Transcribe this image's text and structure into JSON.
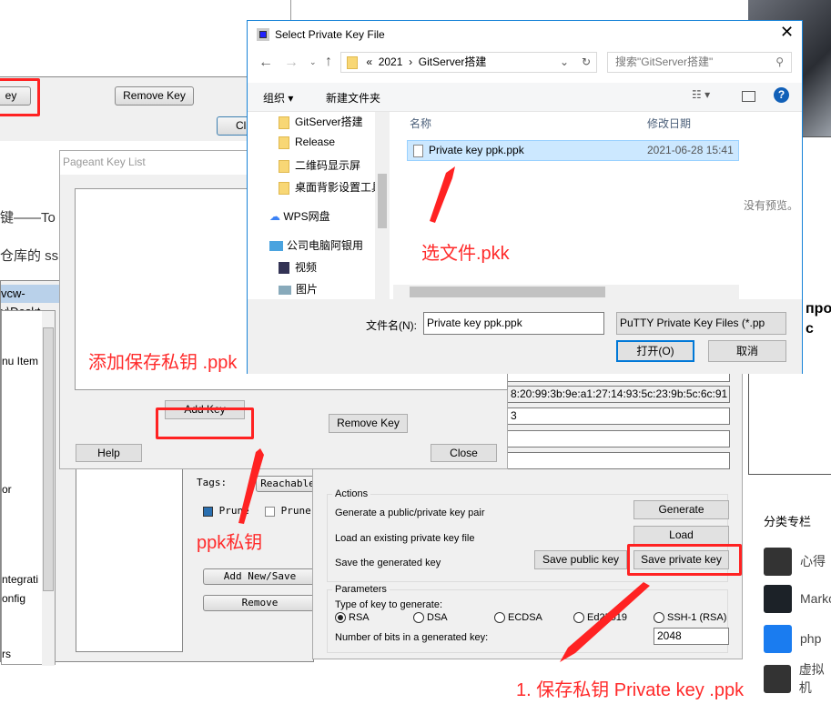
{
  "old_pageant": {
    "add_key_partial": "ey",
    "remove_key": "Remove Key",
    "close_partial": "Cl"
  },
  "blog": {
    "line1": "键——To",
    "line2": "仓库的 ssh",
    "sidebar_heading_partial": "про\nс",
    "category_title": "分类专栏",
    "categories": [
      "心得",
      "Marko",
      "php",
      "虚拟机"
    ],
    "no_preview": "没有预览。"
  },
  "tortoise": {
    "path_partial": "vcw-v\\Deskt",
    "tree": [
      "nu Item",
      "or",
      "ntegrati",
      "onfig",
      "rs"
    ],
    "tags_label": "Tags:",
    "reachable": "Reachable",
    "prune1": "Prune",
    "prune2": "Prune",
    "add_new_save": "Add New/Save",
    "remove": "Remove"
  },
  "puttygen": {
    "fingerprint": "8:20:99:3b:9e:a1:27:14:93:5c:23:9b:5c:6c:91",
    "comment_partial": "3",
    "actions_title": "Actions",
    "generate_label": "Generate a public/private key pair",
    "generate_btn": "Generate",
    "load_label": "Load an existing private key file",
    "load_btn": "Load",
    "save_label": "Save the generated key",
    "save_public": "Save public key",
    "save_private": "Save private key",
    "params_title": "Parameters",
    "type_label": "Type of key to generate:",
    "key_types": [
      "RSA",
      "DSA",
      "ECDSA",
      "Ed25519",
      "SSH-1 (RSA)"
    ],
    "selected_type": "RSA",
    "bits_label": "Number of bits in a generated key:",
    "bits": "2048"
  },
  "pageant": {
    "title": "Pageant Key List",
    "add_key": "Add Key",
    "remove_key": "Remove Key",
    "help": "Help",
    "close": "Close"
  },
  "file_dialog": {
    "title": "Select Private Key File",
    "breadcrumb": [
      "«",
      "2021",
      "›",
      "GitServer搭建"
    ],
    "search_placeholder": "搜索\"GitServer搭建\"",
    "organize": "组织 ▾",
    "new_folder": "新建文件夹",
    "nav": [
      "GitServer搭建",
      "Release",
      "二维码显示屏",
      "桌面背影设置工具",
      "WPS网盘",
      "公司电脑阿银用",
      "视频",
      "图片"
    ],
    "col_name": "名称",
    "col_date": "修改日期",
    "files": [
      {
        "name": "Private key ppk.ppk",
        "date": "2021-06-28 15:41"
      }
    ],
    "filename_label": "文件名(N):",
    "filename": "Private key ppk.ppk",
    "filter": "PuTTY Private Key Files (*.pp",
    "open": "打开(O)",
    "cancel": "取消"
  },
  "annotations": {
    "select_file": "选文件.pkk",
    "add_ppk": "添加保存私钥 .ppk",
    "ppk_key": "ppk私钥",
    "save_step": "1. 保存私钥 Private key .ppk"
  },
  "colors": {
    "annotation": "#ff2a2a",
    "selection": "#cce8ff",
    "accent": "#0078d7"
  }
}
